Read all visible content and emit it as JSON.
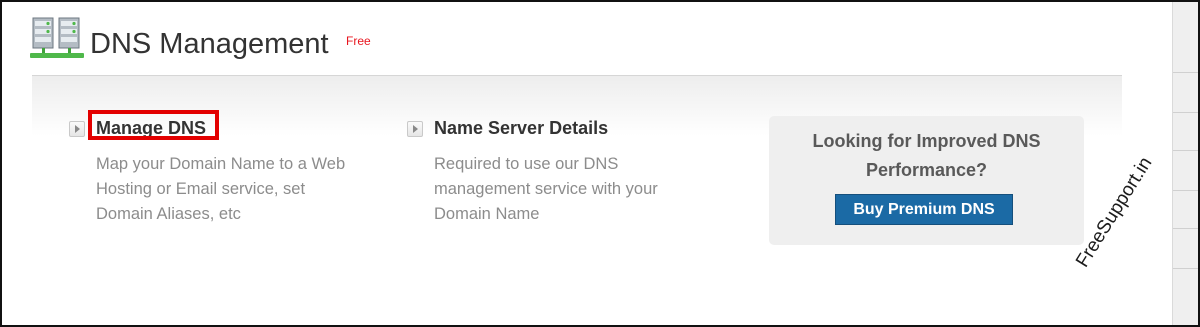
{
  "header": {
    "title": "DNS Management",
    "badge": "Free",
    "icon": "server-icon"
  },
  "options": [
    {
      "title": "Manage DNS",
      "description_lines": [
        "Map your Domain Name to a Web",
        "Hosting or Email service, set",
        "Domain Aliases, etc"
      ],
      "icon": "arrow-right-icon"
    },
    {
      "title": "Name Server Details",
      "description_lines": [
        "Required to use our DNS",
        "management service with your",
        "Domain Name"
      ],
      "icon": "arrow-right-icon"
    }
  ],
  "promo": {
    "text_lines": [
      "Looking for Improved DNS",
      "Performance?"
    ],
    "button_label": "Buy Premium DNS"
  },
  "watermark": "FreeSupport.in",
  "colors": {
    "badge": "#e8151e",
    "highlight": "#e30000",
    "button": "#1b6aa5",
    "description": "#8c8c8c"
  }
}
